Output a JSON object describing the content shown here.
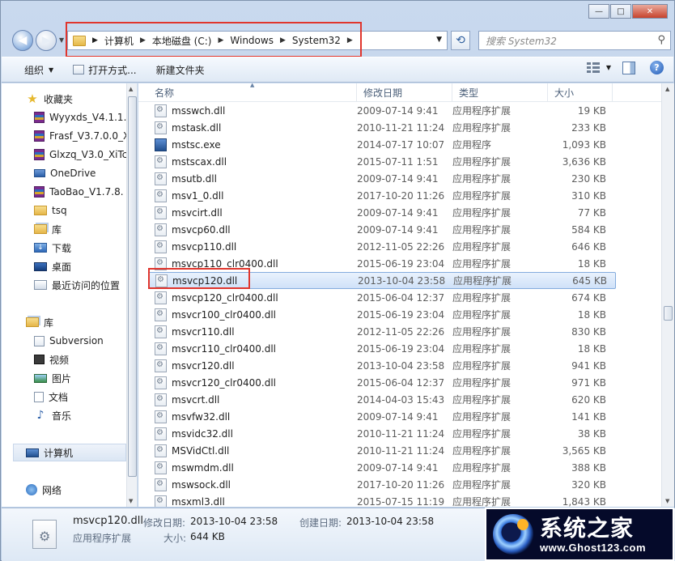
{
  "window": {
    "caption": {
      "minimize": "—",
      "maximize": "□",
      "close": "✕"
    }
  },
  "address": {
    "crumbs": [
      "计算机",
      "本地磁盘 (C:)",
      "Windows",
      "System32"
    ],
    "search_placeholder": "搜索 System32"
  },
  "toolbar": {
    "organize": "组织",
    "open_with": "打开方式...",
    "new_folder": "新建文件夹"
  },
  "navpane": {
    "favorites": "收藏夹",
    "fav_items": [
      "Wyyxds_V4.1.1.",
      "Frasf_V3.7.0.0_X",
      "Glxzq_V3.0_XiTc",
      "OneDrive",
      "TaoBao_V1.7.8.",
      "tsq",
      "库",
      "下载",
      "桌面",
      "最近访问的位置"
    ],
    "libraries": "库",
    "lib_items": [
      "Subversion",
      "视频",
      "图片",
      "文档",
      "音乐"
    ],
    "computer": "计算机",
    "network": "网络"
  },
  "columns": {
    "name": "名称",
    "date": "修改日期",
    "type": "类型",
    "size": "大小"
  },
  "files": [
    {
      "name": "msswch.dll",
      "date": "2009-07-14 9:41",
      "type": "应用程序扩展",
      "size": "19 KB"
    },
    {
      "name": "mstask.dll",
      "date": "2010-11-21 11:24",
      "type": "应用程序扩展",
      "size": "233 KB"
    },
    {
      "name": "mstsc.exe",
      "date": "2014-07-17 10:07",
      "type": "应用程序",
      "size": "1,093 KB"
    },
    {
      "name": "mstscax.dll",
      "date": "2015-07-11 1:51",
      "type": "应用程序扩展",
      "size": "3,636 KB"
    },
    {
      "name": "msutb.dll",
      "date": "2009-07-14 9:41",
      "type": "应用程序扩展",
      "size": "230 KB"
    },
    {
      "name": "msv1_0.dll",
      "date": "2017-10-20 11:26",
      "type": "应用程序扩展",
      "size": "310 KB"
    },
    {
      "name": "msvcirt.dll",
      "date": "2009-07-14 9:41",
      "type": "应用程序扩展",
      "size": "77 KB"
    },
    {
      "name": "msvcp60.dll",
      "date": "2009-07-14 9:41",
      "type": "应用程序扩展",
      "size": "584 KB"
    },
    {
      "name": "msvcp110.dll",
      "date": "2012-11-05 22:26",
      "type": "应用程序扩展",
      "size": "646 KB"
    },
    {
      "name": "msvcp110_clr0400.dll",
      "date": "2015-06-19 23:04",
      "type": "应用程序扩展",
      "size": "18 KB"
    },
    {
      "name": "msvcp120.dll",
      "date": "2013-10-04 23:58",
      "type": "应用程序扩展",
      "size": "645 KB"
    },
    {
      "name": "msvcp120_clr0400.dll",
      "date": "2015-06-04 12:37",
      "type": "应用程序扩展",
      "size": "674 KB"
    },
    {
      "name": "msvcr100_clr0400.dll",
      "date": "2015-06-19 23:04",
      "type": "应用程序扩展",
      "size": "18 KB"
    },
    {
      "name": "msvcr110.dll",
      "date": "2012-11-05 22:26",
      "type": "应用程序扩展",
      "size": "830 KB"
    },
    {
      "name": "msvcr110_clr0400.dll",
      "date": "2015-06-19 23:04",
      "type": "应用程序扩展",
      "size": "18 KB"
    },
    {
      "name": "msvcr120.dll",
      "date": "2013-10-04 23:58",
      "type": "应用程序扩展",
      "size": "941 KB"
    },
    {
      "name": "msvcr120_clr0400.dll",
      "date": "2015-06-04 12:37",
      "type": "应用程序扩展",
      "size": "971 KB"
    },
    {
      "name": "msvcrt.dll",
      "date": "2014-04-03 15:43",
      "type": "应用程序扩展",
      "size": "620 KB"
    },
    {
      "name": "msvfw32.dll",
      "date": "2009-07-14 9:41",
      "type": "应用程序扩展",
      "size": "141 KB"
    },
    {
      "name": "msvidc32.dll",
      "date": "2010-11-21 11:24",
      "type": "应用程序扩展",
      "size": "38 KB"
    },
    {
      "name": "MSVidCtl.dll",
      "date": "2010-11-21 11:24",
      "type": "应用程序扩展",
      "size": "3,565 KB"
    },
    {
      "name": "mswmdm.dll",
      "date": "2009-07-14 9:41",
      "type": "应用程序扩展",
      "size": "388 KB"
    },
    {
      "name": "mswsock.dll",
      "date": "2017-10-20 11:26",
      "type": "应用程序扩展",
      "size": "320 KB"
    },
    {
      "name": "msxml3.dll",
      "date": "2015-07-15 11:19",
      "type": "应用程序扩展",
      "size": "1,843 KB"
    }
  ],
  "selected_index": 10,
  "details": {
    "filename": "msvcp120.dll",
    "modified_label": "修改日期:",
    "modified_value": "2013-10-04 23:58",
    "created_label": "创建日期:",
    "created_value": "2013-10-04 23:58",
    "type": "应用程序扩展",
    "size_label": "大小:",
    "size_value": "644 KB"
  },
  "watermark": {
    "title": "系统之家",
    "url": "www.Ghost123.com"
  },
  "colors": {
    "highlight_red": "#e0352d",
    "selection_blue": "#cfe1f8"
  }
}
